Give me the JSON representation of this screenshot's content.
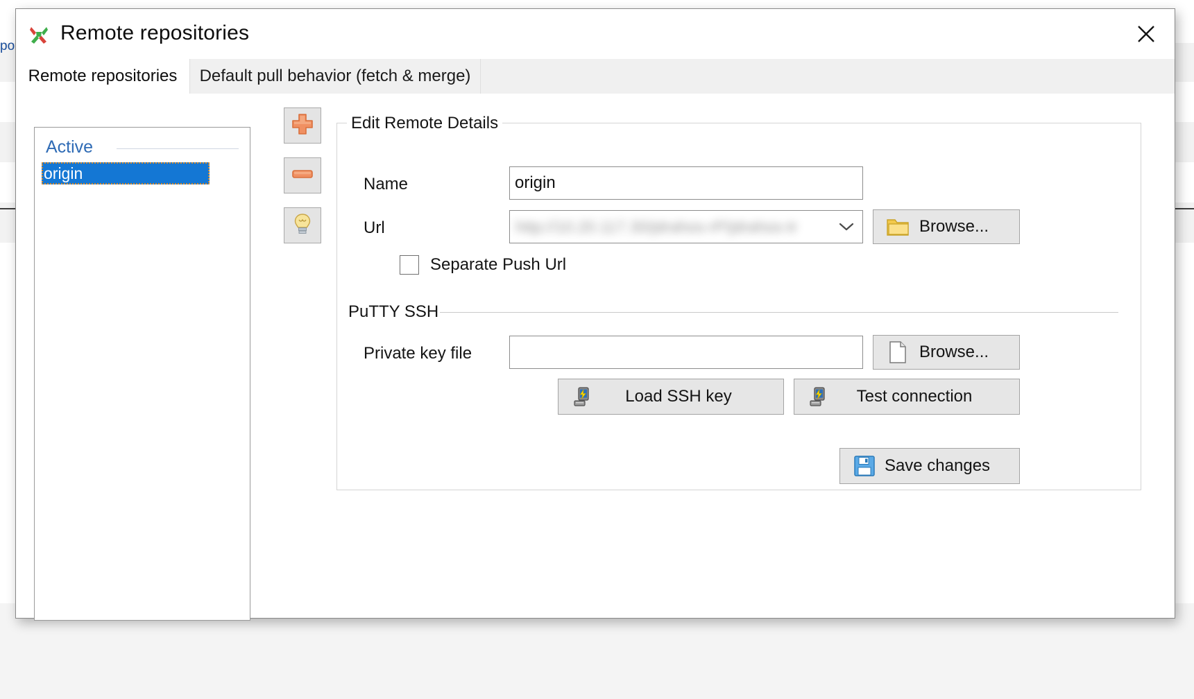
{
  "background": {
    "partial_text": "po"
  },
  "window": {
    "title": "Remote repositories",
    "app_icon": "git-extensions-icon",
    "close_label": "✕"
  },
  "tabs": [
    {
      "label": "Remote repositories",
      "active": true
    },
    {
      "label": "Default pull behavior (fetch & merge)",
      "active": false
    }
  ],
  "remotes_panel": {
    "group_label": "Active",
    "items": [
      {
        "label": "origin",
        "selected": true
      }
    ]
  },
  "toolbar": {
    "add_icon": "plus-icon",
    "remove_icon": "minus-icon",
    "hint_icon": "lightbulb-icon"
  },
  "edit_group": {
    "caption": "Edit Remote Details",
    "name_label": "Name",
    "name_value": "origin",
    "url_label": "Url",
    "url_value": "http://10.20.117.30/jdrahos-rP/jdrahos-tr",
    "url_browse_label": "Browse...",
    "url_browse_icon": "folder-icon",
    "dropdown_icon": "chevron-down-icon",
    "separate_push_label": "Separate Push Url",
    "separate_push_checked": false
  },
  "putty_section": {
    "title": "PuTTY SSH",
    "private_key_label": "Private key file",
    "private_key_value": "",
    "private_key_browse_label": "Browse...",
    "private_key_browse_icon": "document-icon",
    "load_key_label": "Load SSH key",
    "load_key_icon": "putty-icon",
    "test_connection_label": "Test connection",
    "test_connection_icon": "putty-icon"
  },
  "actions": {
    "save_label": "Save changes",
    "save_icon": "floppy-disk-icon"
  },
  "colors": {
    "selection_blue": "#1477d4",
    "group_header_blue": "#2f6bb5",
    "accent_orange": "#ef8e4e",
    "dialog_bg": "#ffffff",
    "tab_bg": "#f0f0f0",
    "button_bg": "#e6e6e6"
  }
}
